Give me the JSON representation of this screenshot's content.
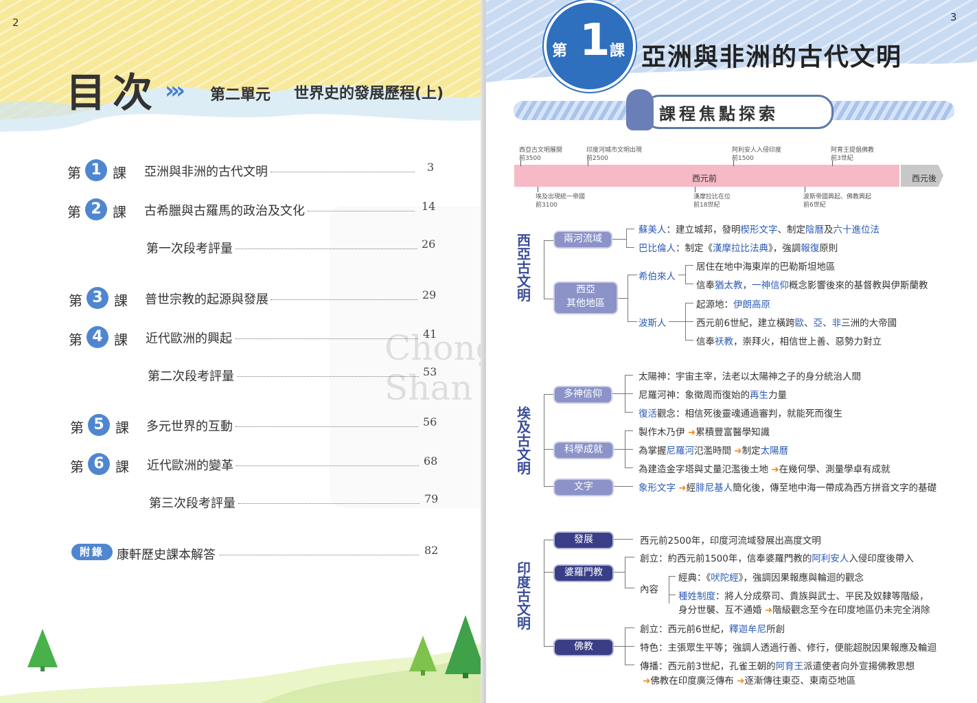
{
  "left_page": {
    "page_number": "2",
    "header": {
      "title": "目次",
      "arrows": "»",
      "unit": "第二單元",
      "subtitle": "世界史的發展歷程(上)"
    },
    "toc": [
      {
        "prefix": "第",
        "num": "1",
        "suffix": "課",
        "title": "亞洲與非洲的古代文明",
        "page": "3"
      },
      {
        "prefix": "第",
        "num": "2",
        "suffix": "課",
        "title": "古希臘與古羅馬的政治及文化",
        "page": "14"
      },
      {
        "title": "第一次段考評量",
        "page": "26"
      },
      {
        "prefix": "第",
        "num": "3",
        "suffix": "課",
        "title": "普世宗教的起源與發展",
        "page": "29"
      },
      {
        "prefix": "第",
        "num": "4",
        "suffix": "課",
        "title": "近代歐洲的興起",
        "page": "41"
      },
      {
        "title": "第二次段考評量",
        "page": "53"
      },
      {
        "prefix": "第",
        "num": "5",
        "suffix": "課",
        "title": "多元世界的互動",
        "page": "56"
      },
      {
        "prefix": "第",
        "num": "6",
        "suffix": "課",
        "title": "近代歐洲的變革",
        "page": "68"
      },
      {
        "title": "第三次段考評量",
        "page": "79"
      }
    ],
    "appendix": {
      "badge": "附錄",
      "title": "康軒歷史課本解答",
      "page": "82"
    },
    "watermark": "Chong Shan"
  },
  "right_page": {
    "page_number": "3",
    "lesson": {
      "prefix": "第",
      "num": "1",
      "suffix": "課",
      "title": "亞洲與非洲的古代文明"
    },
    "section_title": "課程焦點探索",
    "timeline": {
      "bc_label": "西元前",
      "ad_label": "西元後",
      "above": [
        {
          "text": "西亞古文明展開",
          "date": "前3500"
        },
        {
          "text": "印度河城市文明出現",
          "date": "前2500"
        },
        {
          "text": "阿利安人入侵印度",
          "date": "前1500"
        },
        {
          "text": "阿育王提倡佛教",
          "date": "前3世紀"
        }
      ],
      "below": [
        {
          "text": "埃及出現統一帝國",
          "date": "前3100"
        },
        {
          "text": "漢摩拉比在位",
          "date": "前18世紀"
        },
        {
          "text": "波斯帝國興起、佛教興起",
          "date": "前6世紀"
        }
      ]
    },
    "mindmap": {
      "west_asia": {
        "label": "西亞古文明",
        "rivers": {
          "node": "兩河流域",
          "sumer": {
            "name": "蘇美人",
            "a": "：建立城邦，發明",
            "b": "楔形文字",
            "c": "、制定",
            "d": "陰曆",
            "e": "及",
            "f": "六十進位法"
          },
          "babylon": {
            "name": "巴比倫人",
            "a": "：制定《",
            "b": "漢摩拉比法典",
            "c": "》，強調",
            "d": "報復",
            "e": "原則"
          }
        },
        "others": {
          "node1": "西亞",
          "node2": "其他地區",
          "hebrew": {
            "name": "希伯來人",
            "l1": "居住在地中海東岸的巴勒斯坦地區",
            "l2a": "信奉",
            "l2b": "猶太教",
            "l2c": "，",
            "l2d": "一神信仰",
            "l2e": "概念影響後來的基督教與伊斯蘭教"
          },
          "persia": {
            "name": "波斯人",
            "l1a": "起源地：",
            "l1b": "伊朗高原",
            "l2a": "西元前6世紀，建立橫跨",
            "l2b": "歐",
            "l2c": "、",
            "l2d": "亞",
            "l2e": "、",
            "l2f": "非",
            "l2g": "三洲的大帝國",
            "l3a": "信奉",
            "l3b": "祆教",
            "l3c": "，崇拜火，相信世上善、惡勢力對立"
          }
        }
      },
      "egypt": {
        "label": "埃及古文明",
        "poly": {
          "node": "多神信仰",
          "l1": "太陽神：宇宙主宰，法老以太陽神之子的身分統治人間",
          "l2a": "尼羅河神：象徵周而復始的",
          "l2b": "再生",
          "l2c": "力量",
          "l3a": "復活",
          "l3b": "觀念：相信死後靈魂通過審判，就能死而復生"
        },
        "science": {
          "node": "科學成就",
          "l1a": "製作木乃伊",
          "l1b": "累積豐富醫學知識",
          "l2a": "為掌握",
          "l2b": "尼羅河",
          "l2c": "氾濫時間",
          "l2d": "制定",
          "l2e": "太陽曆",
          "l3a": "為建造金字塔與丈量氾濫後土地",
          "l3b": "在幾何學、測量學卓有成就"
        },
        "writing": {
          "node": "文字",
          "a": "象形文字",
          "b": "經",
          "c": "腓尼基人",
          "d": "簡化後，傳至地中海一帶成為西方拼音文字的基礎"
        }
      },
      "india": {
        "label": "印度古文明",
        "dev": {
          "node": "發展",
          "text": "西元前2500年，印度河流域發展出高度文明"
        },
        "brahman": {
          "node": "婆羅門教",
          "l1a": "創立：約西元前1500年，信奉婆羅門教的",
          "l1b": "阿利安人",
          "l1c": "入侵印度後帶入",
          "content": "內容",
          "l2a": "經典：《",
          "l2b": "吠陀經",
          "l2c": "》，強調因果報應與輪迴的觀念",
          "l3a": "種姓制度",
          "l3b": "：將人分成祭司、貴族與武士、平民及奴隸等階級，",
          "l4a": "身分世襲、互不通婚",
          "l4b": "階級觀念至今在印度地區仍未完全消除"
        },
        "buddhism": {
          "node": "佛教",
          "l1a": "創立：西元前6世紀，",
          "l1b": "釋迦牟尼",
          "l1c": "所創",
          "l2": "特色：主張眾生平等；強調人透過行善、修行，便能超脫因果報應及輪迴",
          "l3a": "傳播：西元前3世紀，孔雀王朝的",
          "l3b": "阿育王",
          "l3c": "派遣使者向外宣揚佛教思想",
          "l4a": "佛教在印度廣泛傳布",
          "l4b": "逐漸傳往東亞、東南亞地區"
        }
      }
    }
  },
  "colors": {
    "accent_blue": "#4f86d0",
    "dark_blue": "#2e6fbe",
    "node_light": "#8b93c8",
    "node_dark": "#3a3e86",
    "keyword": "#2d5bb5",
    "arrow": "#f08c1a",
    "timeline_bc": "#f6b9c6",
    "timeline_ad": "#c8c8c8"
  },
  "icons": [
    "double-chevron-icon",
    "bear-mascot-icon",
    "tree-icon",
    "arrow-right-icon"
  ]
}
